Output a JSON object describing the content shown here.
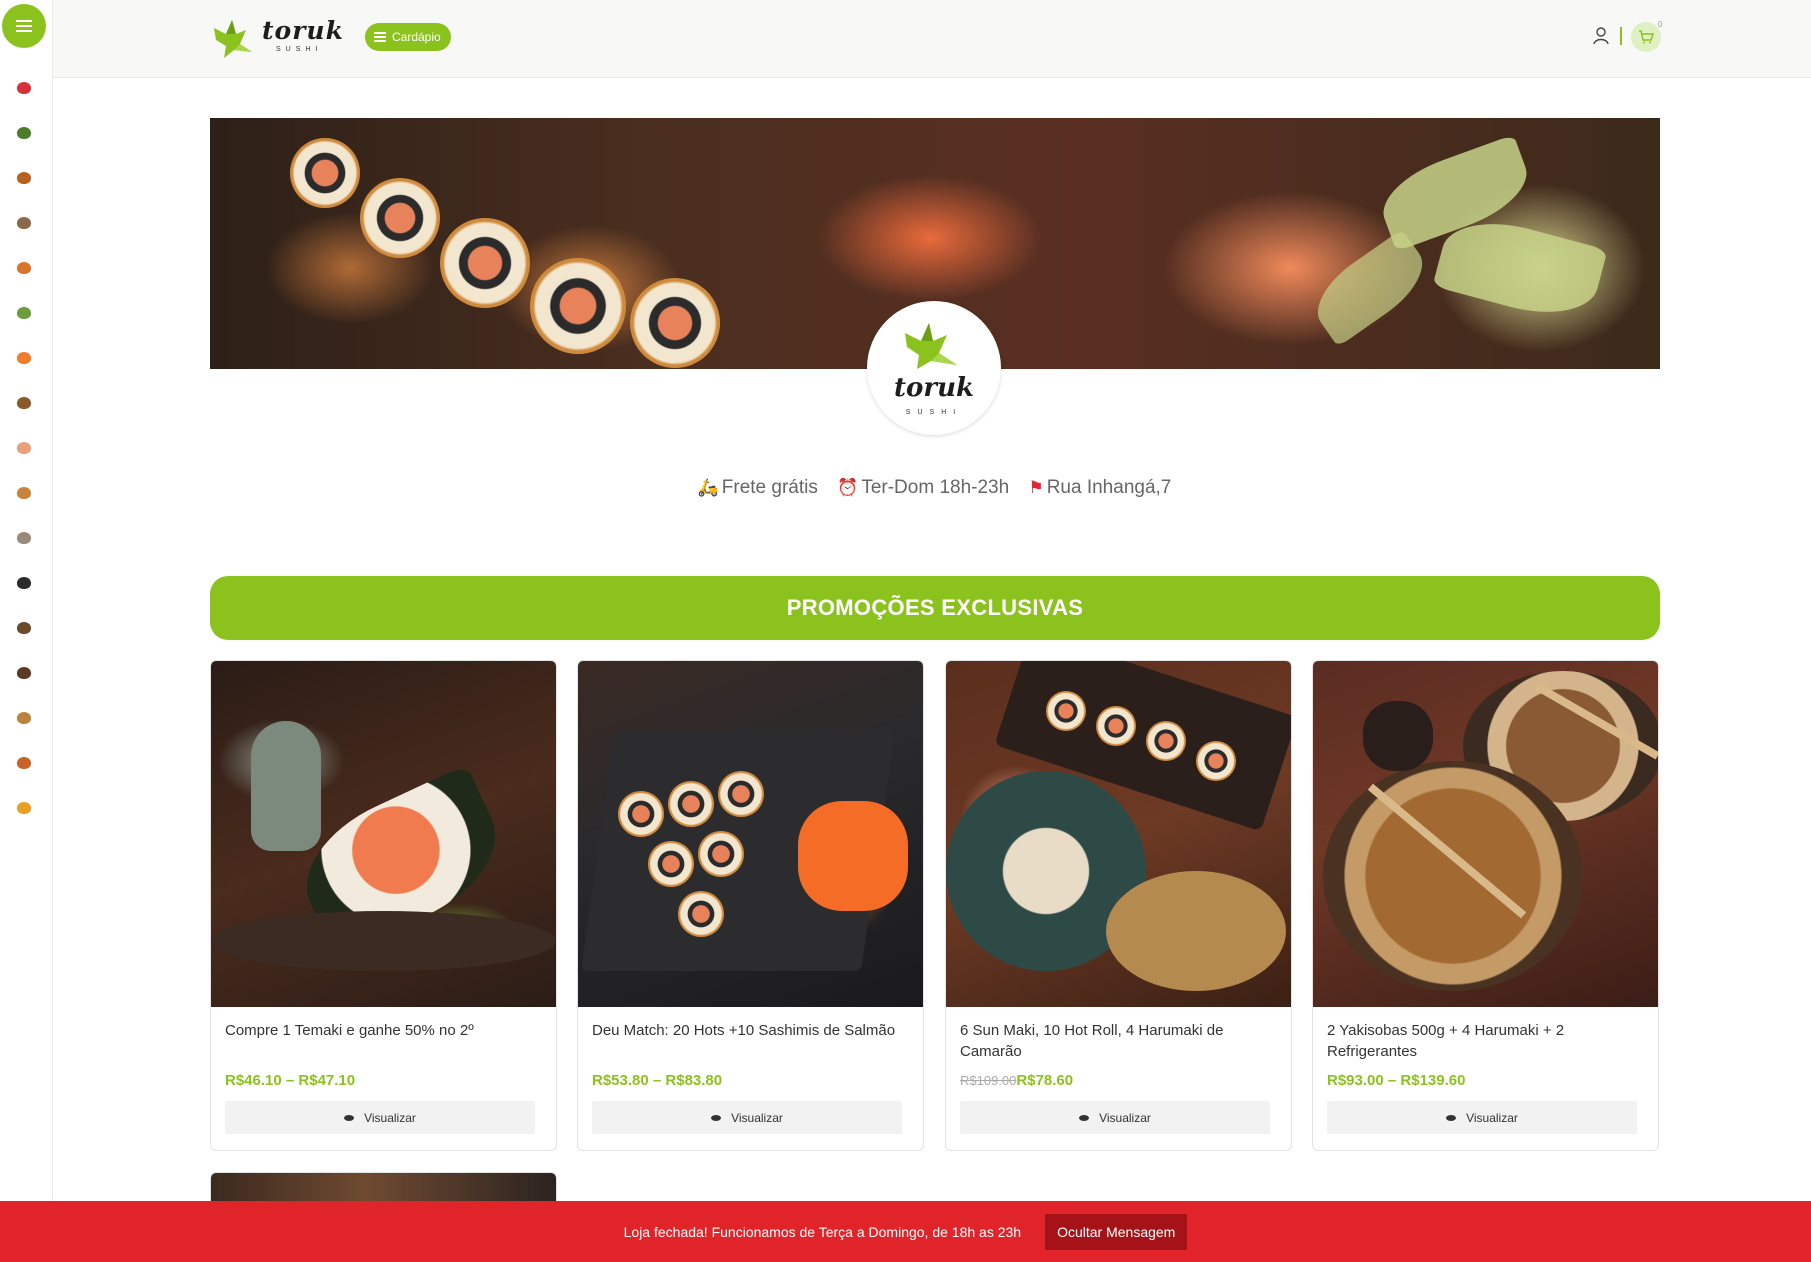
{
  "sidebar": {
    "categories": [
      {
        "icon": "tuna-nigiri-icon",
        "color": "#d8313a"
      },
      {
        "icon": "hossomaki-icon",
        "color": "#4c7d2a"
      },
      {
        "icon": "hot-roll-icon",
        "color": "#b8621f"
      },
      {
        "icon": "nigiri-icon",
        "color": "#8a6a4a"
      },
      {
        "icon": "shrimp-icon",
        "color": "#d8752d"
      },
      {
        "icon": "salad-icon",
        "color": "#6c9c3c"
      },
      {
        "icon": "salmon-slice-icon",
        "color": "#f07c2c"
      },
      {
        "icon": "mushroom-icon",
        "color": "#8a5a2a"
      },
      {
        "icon": "uramaki-icon",
        "color": "#e8a07c"
      },
      {
        "icon": "sandwich-icon",
        "color": "#c8843c"
      },
      {
        "icon": "combo-icon",
        "color": "#9a8a7a"
      },
      {
        "icon": "dark-roll-icon",
        "color": "#2b2b2b"
      },
      {
        "icon": "temaki-icon",
        "color": "#6a4a2a"
      },
      {
        "icon": "cone-icon",
        "color": "#5a3a22"
      },
      {
        "icon": "noodles-icon",
        "color": "#b8843c"
      },
      {
        "icon": "fried-icon",
        "color": "#c8622a"
      },
      {
        "icon": "drink-icon",
        "color": "#e8a022"
      }
    ]
  },
  "header": {
    "logo_word": "toruk",
    "logo_sub": "SUSHI",
    "menu_label": "Cardápio",
    "cart_count": "0",
    "accent": "#8cc21e"
  },
  "store": {
    "logo_word": "toruk",
    "logo_sub": "SUSHI",
    "delivery": "Frete grátis",
    "hours": "Ter-Dom 18h-23h",
    "address": "Rua Inhangá,7"
  },
  "promo": {
    "title": "PROMOÇÕES EXCLUSIVAS"
  },
  "products": [
    {
      "title": "Compre 1 Temaki e ganhe 50% no 2º",
      "price": "R$46.10 – R$47.10",
      "old_price": "",
      "button": "Visualizar"
    },
    {
      "title": "Deu Match: 20 Hots +10 Sashimis de Salmão",
      "price": "R$53.80 – R$83.80",
      "old_price": "",
      "button": "Visualizar"
    },
    {
      "title": "6 Sun Maki, 10 Hot Roll, 4 Harumaki de Camarão",
      "price": "R$78.60",
      "old_price": "R$109.00",
      "button": "Visualizar"
    },
    {
      "title": "2 Yakisobas 500g + 4 Harumaki + 2 Refrigerantes",
      "price": "R$93.00 – R$139.60",
      "old_price": "",
      "button": "Visualizar"
    }
  ],
  "notice": {
    "message": "Loja fechada! Funcionamos de Terça a Domingo, de 18h as 23h",
    "button": "Ocultar Mensagem",
    "color": "#e1232a"
  }
}
